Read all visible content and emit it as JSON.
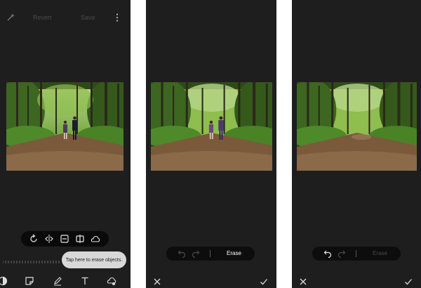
{
  "screens": [
    {
      "top_bar": {
        "revert_label": "Revert",
        "save_label": "Save"
      },
      "toolbar_icons": [
        "rotate-icon",
        "flip-icon",
        "resize-icon",
        "crop-icon",
        "object-eraser-icon"
      ],
      "tooltip": "Tap here to erase objects.",
      "bottom_icons": [
        "filter-icon",
        "sticker-icon",
        "draw-icon",
        "text-icon",
        "object-eraser-icon"
      ]
    },
    {
      "erase_label": "Erase",
      "erase_state": "active",
      "undo_enabled": false,
      "redo_enabled": false,
      "bottom_icons": [
        "cancel-icon",
        "confirm-icon"
      ]
    },
    {
      "erase_label": "Erase",
      "erase_state": "disabled",
      "undo_enabled": true,
      "redo_enabled": false,
      "bottom_icons": [
        "cancel-icon",
        "confirm-icon"
      ]
    }
  ],
  "colors": {
    "background": "#1e1e1f",
    "pill": "#0a0a0a",
    "tooltip": "#d8d8d8",
    "text_active": "#ffffff",
    "text_dim": "#4a4a4a"
  }
}
